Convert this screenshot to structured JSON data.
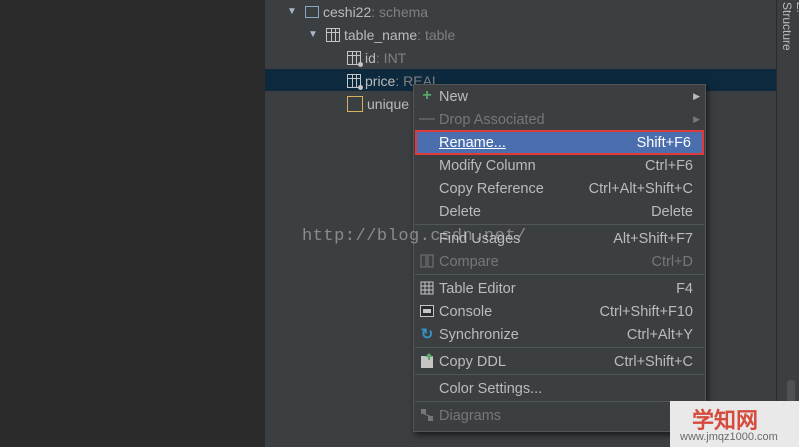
{
  "tree": {
    "schema": {
      "name": "ceshi22",
      "kind": ": schema"
    },
    "table": {
      "name": "table_name",
      "kind": ": table"
    },
    "columns": [
      {
        "name": "id",
        "kind": ": INT"
      },
      {
        "name": "price",
        "kind": ": REAL"
      },
      {
        "name": "unique"
      }
    ]
  },
  "side_tab": {
    "label": "Z: Structure"
  },
  "context_menu": {
    "items": [
      {
        "label": "New",
        "shortcut": "",
        "icon": "plus-icon",
        "submenu": true,
        "disabled": false
      },
      {
        "label": "Drop Associated",
        "shortcut": "",
        "icon": "minus-icon",
        "submenu": true,
        "disabled": true
      },
      {
        "label": "Rename...",
        "shortcut": "Shift+F6",
        "highlighted": true
      },
      {
        "label": "Modify Column",
        "shortcut": "Ctrl+F6"
      },
      {
        "label": "Copy Reference",
        "shortcut": "Ctrl+Alt+Shift+C"
      },
      {
        "label": "Delete",
        "shortcut": "Delete"
      },
      {
        "label": "Find Usages",
        "shortcut": "Alt+Shift+F7"
      },
      {
        "label": "Compare",
        "shortcut": "Ctrl+D",
        "icon": "compare-icon",
        "disabled": true
      },
      {
        "label": "Table Editor",
        "shortcut": "F4",
        "icon": "table-icon"
      },
      {
        "label": "Console",
        "shortcut": "Ctrl+Shift+F10",
        "icon": "console-icon"
      },
      {
        "label": "Synchronize",
        "shortcut": "Ctrl+Alt+Y",
        "icon": "sync-icon"
      },
      {
        "label": "Copy DDL",
        "shortcut": "Ctrl+Shift+C",
        "icon": "ddl-icon"
      },
      {
        "label": "Color Settings...",
        "shortcut": ""
      },
      {
        "label": "Diagrams",
        "shortcut": "",
        "icon": "diagram-icon",
        "submenu": true,
        "disabled": true
      }
    ]
  },
  "watermark": "http://blog.csdn.net/",
  "brand": {
    "title": "学知网",
    "url": "www.jmqz1000.com"
  },
  "colors": {
    "menu_bg": "#3c3f41",
    "highlight": "#4b6eaf",
    "highlight_border": "#e03a3a",
    "selection": "#0d293e"
  }
}
